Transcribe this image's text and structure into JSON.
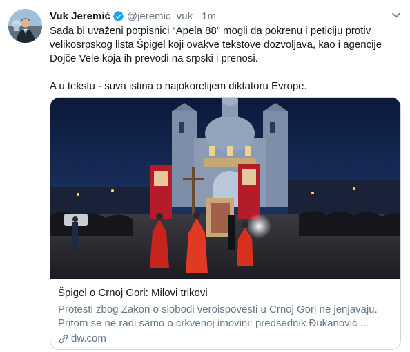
{
  "tweet": {
    "author_name": "Vuk Jeremić",
    "handle": "@jeremic_vuk",
    "separator": "·",
    "time": "1m",
    "body_line_1": "Sada bi uvaženi potpisnici “Apela 88” mogli da pokrenu i peticiju protiv",
    "body_line_2": "velikosrpskog lista Špigel koji ovakve tekstove dozvoljava, kao i agencije",
    "body_line_3": "Dojče Vele koja ih prevodi na srpski i prenosi.",
    "body_line_4": "A u tekstu - suva istina o najokorelijem diktatoru Evrope."
  },
  "card": {
    "title": "Špigel o Crnoj Gori: Milovi trikovi",
    "description_line_1": "Protesti zbog Zakon o slobodi veroispovesti u Crnoj Gori ne jenjavaju.",
    "description_line_2": "Pritom se ne radi samo o crkvenoj imovini: predsednik Đukanović ...",
    "domain": "dw.com"
  },
  "icons": {
    "verified": "verified-badge-icon",
    "caret": "chevron-down-icon",
    "link": "link-icon"
  },
  "colors": {
    "text_primary": "#14171a",
    "text_secondary": "#657786",
    "verified_blue": "#1da1f2",
    "card_border": "#ccd6dd"
  }
}
